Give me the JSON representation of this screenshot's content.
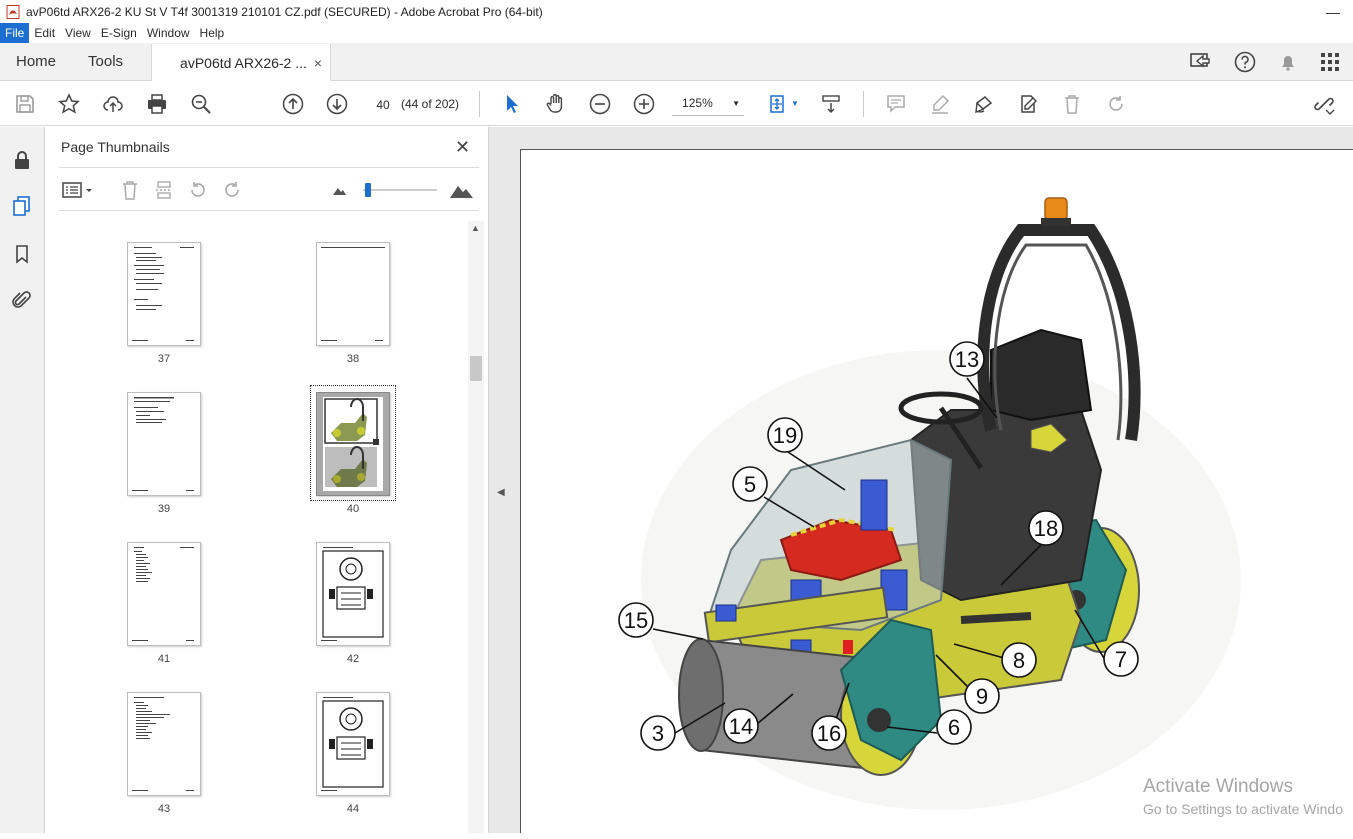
{
  "window": {
    "title": "avP06td ARX26-2 KU St V T4f 3001319 210101 CZ.pdf (SECURED) - Adobe Acrobat Pro (64-bit)",
    "minimize": "—"
  },
  "menu": [
    "File",
    "Edit",
    "View",
    "E-Sign",
    "Window",
    "Help"
  ],
  "tabs": {
    "home": "Home",
    "tools": "Tools",
    "document": "avP06td ARX26-2 ...",
    "close": "×"
  },
  "toolbar": {
    "page_number": "40",
    "page_count": "(44 of 202)",
    "zoom": "125%"
  },
  "panel": {
    "title": "Page Thumbnails",
    "close": "✕",
    "thumbnails": [
      {
        "label": "37"
      },
      {
        "label": "38"
      },
      {
        "label": "39"
      },
      {
        "label": "40",
        "selected": true
      },
      {
        "label": "41"
      },
      {
        "label": "42"
      },
      {
        "label": "43"
      },
      {
        "label": "44"
      }
    ]
  },
  "drawing": {
    "callouts": [
      "13",
      "19",
      "5",
      "18",
      "15",
      "8",
      "7",
      "9",
      "3",
      "14",
      "16",
      "6"
    ]
  },
  "overlay": {
    "line1": "Activate Windows",
    "line2": "Go to Settings to activate Windo"
  },
  "colors": {
    "accent": "#1c6fd1",
    "machine_yellow": "#d6d63a",
    "machine_teal": "#2e8a82",
    "beacon": "#e88a1a"
  }
}
